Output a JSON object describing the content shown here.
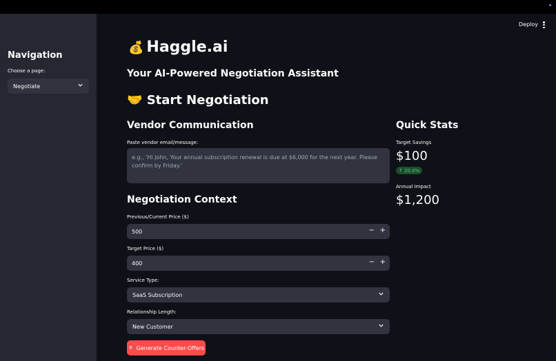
{
  "sidebar": {
    "title": "Navigation",
    "page_label": "Choose a page:",
    "page_value": "Negotiate"
  },
  "header": {
    "deploy_label": "Deploy"
  },
  "main": {
    "app_title": "Haggle.ai",
    "app_emoji": "💰",
    "subtitle": "Your AI-Powered Negotiation Assistant",
    "section_title": "Start Negotiation",
    "section_emoji": "🤝",
    "vendor": {
      "heading": "Vendor Communication",
      "label": "Paste vendor email/message:",
      "placeholder": "e.g., 'Hi John, Your annual subscription renewal is due at $6,000 for the next year. Please confirm by Friday.'"
    },
    "context": {
      "heading": "Negotiation Context",
      "prev_price_label": "Previous/Current Price ($)",
      "prev_price_value": "500",
      "target_price_label": "Target Price ($)",
      "target_price_value": "400",
      "service_label": "Service Type:",
      "service_value": "SaaS Subscription",
      "relationship_label": "Relationship Length:",
      "relationship_value": "New Customer",
      "minus": "−",
      "plus": "+"
    },
    "generate_label": "Generate Counter-Offers",
    "generate_icon": "🎯"
  },
  "stats": {
    "heading": "Quick Stats",
    "target_savings_label": "Target Savings",
    "target_savings_value": "$100",
    "target_savings_delta": "↑ 20.0%",
    "annual_impact_label": "Annual Impact",
    "annual_impact_value": "$1,200"
  },
  "colors": {
    "accent": "#ff4b4b",
    "background": "#0e1117",
    "sidebar": "#262730",
    "input": "#31333f",
    "delta_bg": "#1f4a2e",
    "delta_fg": "#4fd17a"
  }
}
